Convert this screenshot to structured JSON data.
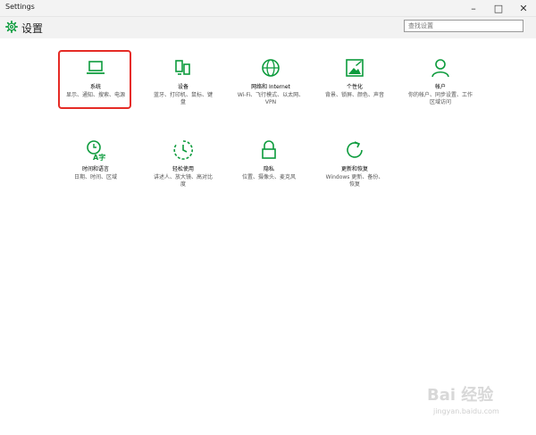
{
  "window": {
    "title": "Settings",
    "controls": [
      "–",
      "□",
      "✕"
    ]
  },
  "header": {
    "title": "设置",
    "icon": "gear-icon",
    "search_placeholder": "查找设置"
  },
  "accent_color": "#0c9b3c",
  "highlight_color": "#e52b25",
  "tiles": [
    {
      "id": "system",
      "icon": "laptop-icon",
      "name": "系统",
      "desc": "显示、通知、搜索、电源",
      "selected": true
    },
    {
      "id": "devices",
      "icon": "devices-icon",
      "name": "设备",
      "desc": "蓝牙、打印机、鼠标、键盘"
    },
    {
      "id": "network",
      "icon": "globe-icon",
      "name": "网络和 Internet",
      "desc": "Wi-Fi、飞行模式、以太网、VPN"
    },
    {
      "id": "personalization",
      "icon": "personalization-icon",
      "name": "个性化",
      "desc": "背景、锁屏、颜色、声音"
    },
    {
      "id": "accounts",
      "icon": "person-icon",
      "name": "帐户",
      "desc": "你的帐户、同步设置、工作区域访问"
    },
    {
      "id": "time",
      "icon": "time-language-icon",
      "name": "时间和语言",
      "desc": "日期、时间、区域"
    },
    {
      "id": "ease",
      "icon": "ease-of-access-icon",
      "name": "轻松使用",
      "desc": "讲述人、放大镜、高对比度"
    },
    {
      "id": "privacy",
      "icon": "lock-icon",
      "name": "隐私",
      "desc": "位置、摄像头、麦克风"
    },
    {
      "id": "update",
      "icon": "refresh-icon",
      "name": "更新和恢复",
      "desc": "Windows 更新、备份、恢复"
    }
  ],
  "watermark": {
    "line1": "Bai 经验",
    "line2": "jingyan.baidu.com"
  }
}
